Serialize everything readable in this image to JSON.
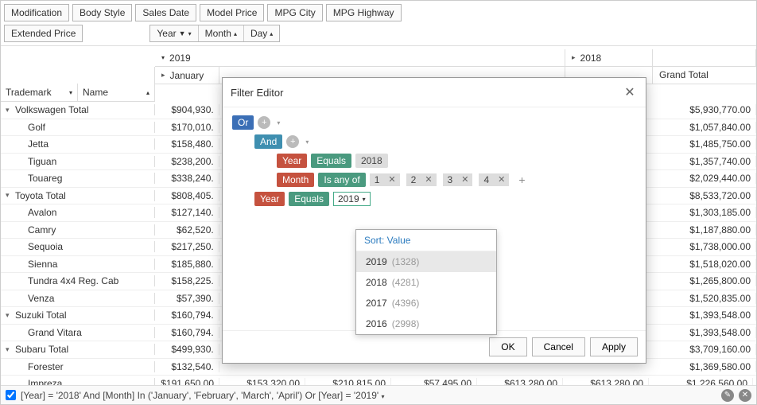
{
  "fields": {
    "modification": "Modification",
    "body_style": "Body Style",
    "sales_date": "Sales Date",
    "model_price": "Model Price",
    "mpg_city": "MPG City",
    "mpg_highway": "MPG Highway",
    "extended_price": "Extended Price"
  },
  "time": {
    "year": "Year",
    "month": "Month",
    "day": "Day"
  },
  "years": {
    "y2019": "2019",
    "y2018": "2018"
  },
  "months": {
    "january": "January"
  },
  "row_cols": {
    "trademark": "Trademark",
    "name": "Name"
  },
  "grand_total_label": "Grand Total",
  "rows": [
    {
      "label": "Volkswagen Total",
      "nested": false,
      "expand": "▾",
      "first": "$904,930.",
      "gt": "$5,930,770.00"
    },
    {
      "label": "Golf",
      "nested": true,
      "first": "$170,010.",
      "gt": "$1,057,840.00"
    },
    {
      "label": "Jetta",
      "nested": true,
      "first": "$158,480.",
      "gt": "$1,485,750.00"
    },
    {
      "label": "Tiguan",
      "nested": true,
      "first": "$238,200.",
      "gt": "$1,357,740.00"
    },
    {
      "label": "Touareg",
      "nested": true,
      "first": "$338,240.",
      "gt": "$2,029,440.00"
    },
    {
      "label": "Toyota Total",
      "nested": false,
      "expand": "▾",
      "first": "$808,405.",
      "gt": "$8,533,720.00"
    },
    {
      "label": "Avalon",
      "nested": true,
      "first": "$127,140.",
      "gt": "$1,303,185.00"
    },
    {
      "label": "Camry",
      "nested": true,
      "first": "$62,520.",
      "gt": "$1,187,880.00"
    },
    {
      "label": "Sequoia",
      "nested": true,
      "first": "$217,250.",
      "gt": "$1,738,000.00"
    },
    {
      "label": "Sienna",
      "nested": true,
      "first": "$185,880.",
      "gt": "$1,518,020.00"
    },
    {
      "label": "Tundra 4x4 Reg. Cab",
      "nested": true,
      "first": "$158,225.",
      "gt": "$1,265,800.00"
    },
    {
      "label": "Venza",
      "nested": true,
      "first": "$57,390.",
      "gt": "$1,520,835.00"
    },
    {
      "label": "Suzuki Total",
      "nested": false,
      "expand": "▾",
      "first": "$160,794.",
      "gt": "$1,393,548.00"
    },
    {
      "label": "Grand Vitara",
      "nested": true,
      "first": "$160,794.",
      "gt": "$1,393,548.00"
    },
    {
      "label": "Subaru Total",
      "nested": false,
      "expand": "▾",
      "first": "$499,930.",
      "gt": "$3,709,160.00"
    },
    {
      "label": "Forester",
      "nested": true,
      "first": "$132,540.",
      "gt": "$1,369,580.00"
    },
    {
      "label": "Impreza",
      "nested": true,
      "first": "$191,650.00",
      "gt": "$1,226,560.00",
      "cells": [
        "$153,320.00",
        "$210,815.00",
        "$57,495.00",
        "$613,280.00",
        "$613,280.00"
      ]
    }
  ],
  "filter_bar": {
    "text": "[Year] = '2018' And [Month] In ('January', 'February', 'March', 'April') Or [Year] = '2019'"
  },
  "dialog": {
    "title": "Filter Editor",
    "or": "Or",
    "and": "And",
    "year": "Year",
    "month": "Month",
    "equals": "Equals",
    "isanyof": "Is any of",
    "val2018": "2018",
    "val2019": "2019",
    "m1": "1",
    "m2": "2",
    "m3": "3",
    "m4": "4",
    "ok": "OK",
    "cancel": "Cancel",
    "apply": "Apply"
  },
  "dropdown": {
    "sort": "Sort: Value",
    "items": [
      {
        "year": "2019",
        "count": "(1328)"
      },
      {
        "year": "2018",
        "count": "(4281)"
      },
      {
        "year": "2017",
        "count": "(4396)"
      },
      {
        "year": "2016",
        "count": "(2998)"
      }
    ]
  }
}
